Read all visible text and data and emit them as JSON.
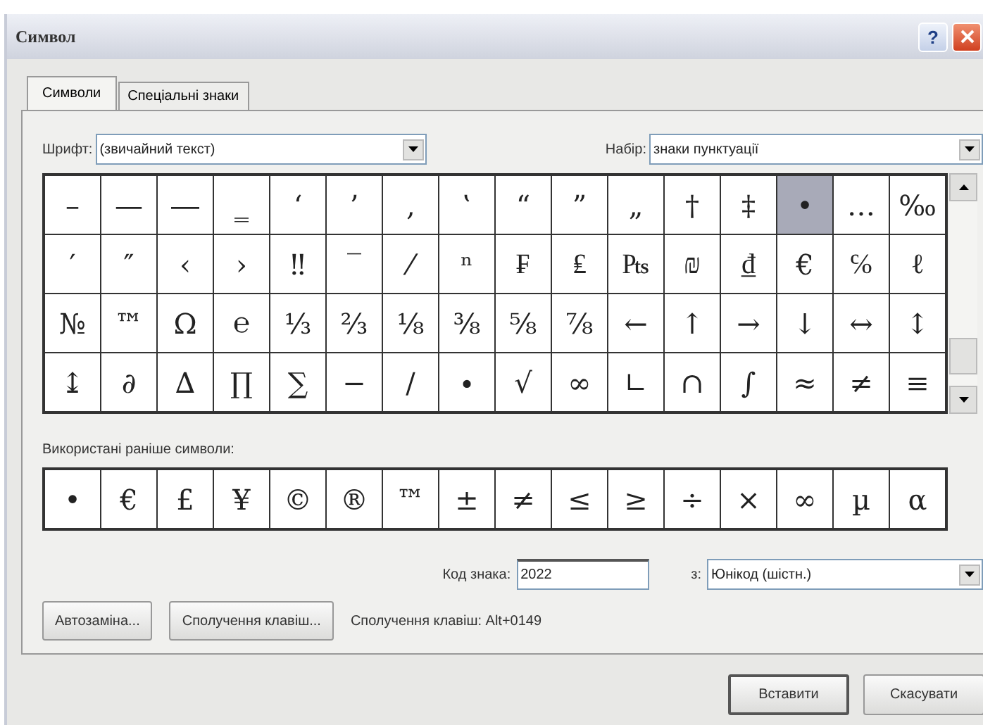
{
  "window": {
    "title": "Символ",
    "help_button": "?"
  },
  "tabs": [
    {
      "label": "Символи",
      "selected": true
    },
    {
      "label": "Спеціальні знаки",
      "selected": false
    }
  ],
  "font": {
    "label": "Шрифт:",
    "value": "(звичайний текст)"
  },
  "subset": {
    "label": "Набір:",
    "value": "знаки пунктуації"
  },
  "symbol_grid": [
    [
      {
        "char": "–",
        "selected": false
      },
      {
        "char": "—",
        "selected": false
      },
      {
        "char": "―",
        "selected": false
      },
      {
        "char": "‗",
        "selected": false
      },
      {
        "char": "‘",
        "selected": false
      },
      {
        "char": "’",
        "selected": false
      },
      {
        "char": "‚",
        "selected": false
      },
      {
        "char": "‛",
        "selected": false
      },
      {
        "char": "“",
        "selected": false
      },
      {
        "char": "”",
        "selected": false
      },
      {
        "char": "„",
        "selected": false
      },
      {
        "char": "†",
        "selected": false
      },
      {
        "char": "‡",
        "selected": false
      },
      {
        "char": "•",
        "selected": true
      },
      {
        "char": "…",
        "selected": false
      },
      {
        "char": "‰",
        "selected": false
      }
    ],
    [
      {
        "char": "′",
        "selected": false
      },
      {
        "char": "″",
        "selected": false
      },
      {
        "char": "‹",
        "selected": false
      },
      {
        "char": "›",
        "selected": false
      },
      {
        "char": "‼",
        "selected": false
      },
      {
        "char": "‾",
        "selected": false
      },
      {
        "char": "⁄",
        "selected": false
      },
      {
        "char": "ⁿ",
        "selected": false
      },
      {
        "char": "₣",
        "selected": false
      },
      {
        "char": "₤",
        "selected": false
      },
      {
        "char": "₧",
        "selected": false
      },
      {
        "char": "₪",
        "selected": false
      },
      {
        "char": "₫",
        "selected": false
      },
      {
        "char": "€",
        "selected": false
      },
      {
        "char": "℅",
        "selected": false
      },
      {
        "char": "ℓ",
        "selected": false
      }
    ],
    [
      {
        "char": "№",
        "selected": false
      },
      {
        "char": "™",
        "selected": false
      },
      {
        "char": "Ω",
        "selected": false
      },
      {
        "char": "℮",
        "selected": false
      },
      {
        "char": "⅓",
        "selected": false
      },
      {
        "char": "⅔",
        "selected": false
      },
      {
        "char": "⅛",
        "selected": false
      },
      {
        "char": "⅜",
        "selected": false
      },
      {
        "char": "⅝",
        "selected": false
      },
      {
        "char": "⅞",
        "selected": false
      },
      {
        "char": "←",
        "selected": false
      },
      {
        "char": "↑",
        "selected": false
      },
      {
        "char": "→",
        "selected": false
      },
      {
        "char": "↓",
        "selected": false
      },
      {
        "char": "↔",
        "selected": false
      },
      {
        "char": "↕",
        "selected": false
      }
    ],
    [
      {
        "char": "↨",
        "selected": false
      },
      {
        "char": "∂",
        "selected": false
      },
      {
        "char": "∆",
        "selected": false
      },
      {
        "char": "∏",
        "selected": false
      },
      {
        "char": "∑",
        "selected": false
      },
      {
        "char": "−",
        "selected": false
      },
      {
        "char": "∕",
        "selected": false
      },
      {
        "char": "∙",
        "selected": false
      },
      {
        "char": "√",
        "selected": false
      },
      {
        "char": "∞",
        "selected": false
      },
      {
        "char": "∟",
        "selected": false
      },
      {
        "char": "∩",
        "selected": false
      },
      {
        "char": "∫",
        "selected": false
      },
      {
        "char": "≈",
        "selected": false
      },
      {
        "char": "≠",
        "selected": false
      },
      {
        "char": "≡",
        "selected": false
      }
    ]
  ],
  "recent": {
    "label": "Використані раніше символи:",
    "symbols": [
      "•",
      "€",
      "£",
      "¥",
      "©",
      "®",
      "™",
      "±",
      "≠",
      "≤",
      "≥",
      "÷",
      "×",
      "∞",
      "µ",
      "α"
    ]
  },
  "code": {
    "label": "Код знака:",
    "value": "2022",
    "from_label": "з:",
    "from_value": "Юнікод (шістн.)"
  },
  "actions": [
    "Автозаміна...",
    "Сполучення клавіш..."
  ],
  "shortcut": "Сполучення клавіш: Alt+0149",
  "buttons": [
    "Вставити",
    "Скасувати"
  ]
}
